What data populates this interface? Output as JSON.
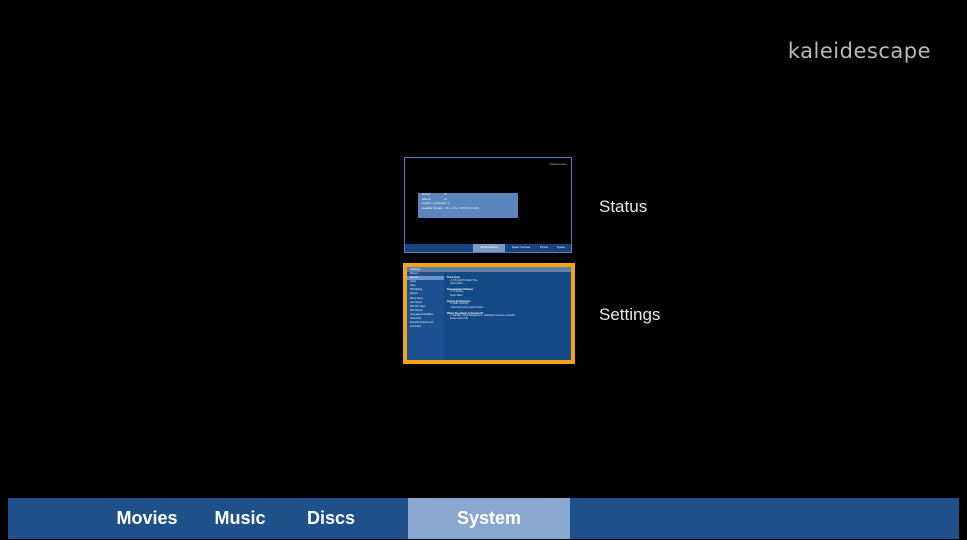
{
  "brand": "kaleidescape",
  "menu": {
    "status": {
      "label": "Status",
      "preview": {
        "brand": "kaleidescape",
        "rows": [
          {
            "k": "Movies",
            "v": "69"
          },
          {
            "k": "Albums",
            "v": "18"
          },
          {
            "k": "Imports in progress",
            "v": "0 / 4"
          },
          {
            "k": "Available Storage",
            "v": "3.8h on Disc (500GB 4K/UHD)"
          }
        ],
        "tabs": [
          "Global Database",
          "System Overview",
          "Imports",
          "System"
        ]
      }
    },
    "settings": {
      "label": "Settings",
      "preview": {
        "header": "Settings",
        "items": [
          "Players",
          "Network",
          "Audio",
          "Video",
          "DVD Rating",
          "Restore",
          "Movie Views",
          "Lab Players",
          "Add Disc Vault",
          "DVD Region",
          "Languages & Subtitles",
          "Passwords",
          "Parental Controls Lock",
          "Controllers"
        ],
        "sections": [
          {
            "title": "Time Zone",
            "options": [
              "✔ (US) (GMT) Pacific Time",
              "Select other..."
            ]
          },
          {
            "title": "Screensaver Themes",
            "options": [
              "✔ TV Archive",
              "Select other..."
            ]
          },
          {
            "title": "Import preferences",
            "options": [
              "✔ Allow Importing",
              "□ Eject disc when import finishes"
            ]
          },
          {
            "title": "When the player is turned off",
            "options": [
              "✔ Standby + Disk Management - Standards continue to standby",
              "Power down (Off)"
            ]
          }
        ]
      }
    }
  },
  "tabs": [
    {
      "label": "Movies"
    },
    {
      "label": "Music"
    },
    {
      "label": "Discs"
    },
    {
      "label": "System",
      "active": true
    }
  ],
  "colors": {
    "accent_focus": "#f2a414",
    "tabbar": "#1e508a",
    "tab_active": "#8aa7d0"
  }
}
